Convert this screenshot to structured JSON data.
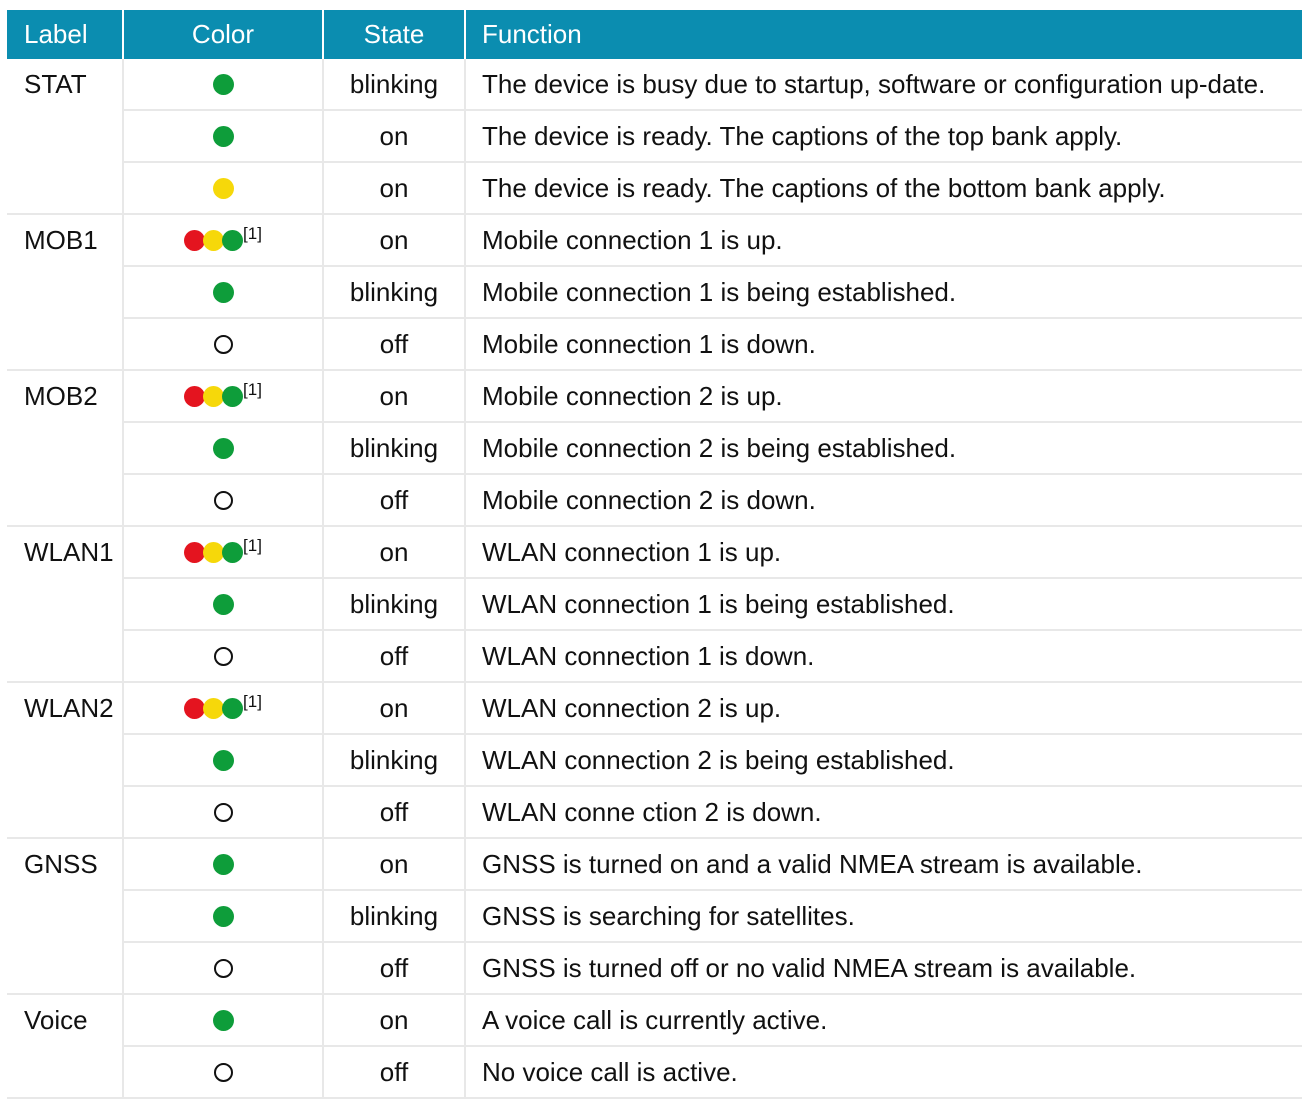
{
  "colors": {
    "header_bg": "#0b8db0",
    "green": "#0e9d3a",
    "yellow": "#f6d80a",
    "red": "#e4141f",
    "divider": "#e8e8e8"
  },
  "header": {
    "label": "Label",
    "color": "Color",
    "state": "State",
    "function": "Function"
  },
  "footnote_marker": "[1]",
  "rows": [
    {
      "label": "STAT",
      "indicator": "green-dot",
      "state": "blinking",
      "function": "The device is busy due to startup, software or configuration up-date."
    },
    {
      "label": "",
      "indicator": "green-dot",
      "state": "on",
      "function": "The device is ready. The captions of the top bank apply."
    },
    {
      "label": "",
      "indicator": "yellow-dot",
      "state": "on",
      "function": "The device is ready. The captions of the bottom bank apply."
    },
    {
      "label": "MOB1",
      "indicator": "red-yellow-green-dots",
      "state": "on",
      "function": "Mobile connection 1 is up."
    },
    {
      "label": "",
      "indicator": "green-dot",
      "state": "blinking",
      "function": "Mobile connection 1 is being established."
    },
    {
      "label": "",
      "indicator": "off-ring",
      "state": "off",
      "function": "Mobile connection 1 is down."
    },
    {
      "label": "MOB2",
      "indicator": "red-yellow-green-dots",
      "state": "on",
      "function": "Mobile connection 2 is up."
    },
    {
      "label": "",
      "indicator": "green-dot",
      "state": "blinking",
      "function": "Mobile connection 2 is being established."
    },
    {
      "label": "",
      "indicator": "off-ring",
      "state": "off",
      "function": "Mobile connection 2 is down."
    },
    {
      "label": "WLAN1",
      "indicator": "red-yellow-green-dots",
      "state": "on",
      "function": "WLAN connection 1 is up."
    },
    {
      "label": "",
      "indicator": "green-dot",
      "state": "blinking",
      "function": "WLAN connection 1 is being established."
    },
    {
      "label": "",
      "indicator": "off-ring",
      "state": "off",
      "function": "WLAN connection 1 is down."
    },
    {
      "label": "WLAN2",
      "indicator": "red-yellow-green-dots",
      "state": "on",
      "function": "WLAN connection 2 is up."
    },
    {
      "label": "",
      "indicator": "green-dot",
      "state": "blinking",
      "function": "WLAN connection 2 is being established."
    },
    {
      "label": "",
      "indicator": "off-ring",
      "state": "off",
      "function": "WLAN conne ction 2 is down."
    },
    {
      "label": "GNSS",
      "indicator": "green-dot",
      "state": "on",
      "function": "GNSS is turned on and a valid NMEA stream is available."
    },
    {
      "label": "",
      "indicator": "green-dot",
      "state": "blinking",
      "function": "GNSS is searching for satellites."
    },
    {
      "label": "",
      "indicator": "off-ring",
      "state": "off",
      "function": "GNSS is turned off or no valid NMEA stream is available."
    },
    {
      "label": "Voice",
      "indicator": "green-dot",
      "state": "on",
      "function": "A voice call is currently active."
    },
    {
      "label": "",
      "indicator": "off-ring",
      "state": "off",
      "function": "No voice call is active."
    }
  ]
}
